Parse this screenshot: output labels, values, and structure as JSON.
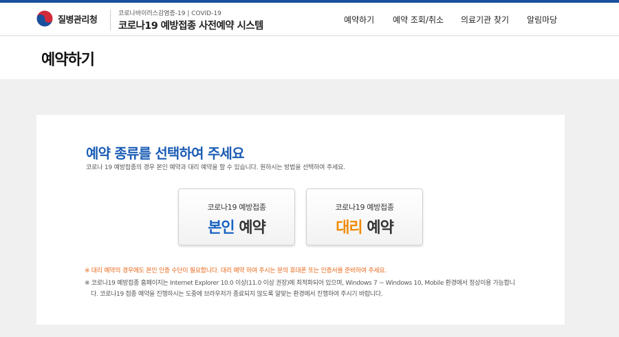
{
  "header": {
    "org_name": "질병관리청",
    "sub_title": "코로나바이러스감염증-19 | COVID-19",
    "system_title": "코로나19 예방접종 사전예약 시스템",
    "nav": [
      "예약하기",
      "예약 조회/취소",
      "의료기관 찾기",
      "알림마당"
    ]
  },
  "page": {
    "title": "예약하기"
  },
  "main": {
    "heading": "예약 종류를 선택하여 주세요",
    "description": "코로나 19 예방접종의 경우 본인 예약과 대리 예약을 할 수 있습니다. 원하시는 방법을 선택하여 주세요.",
    "options": [
      {
        "sub": "코로나19 예방접종",
        "highlight": "본인",
        "main": " 예약"
      },
      {
        "sub": "코로나19 예방접종",
        "highlight": "대리",
        "main": " 예약"
      }
    ],
    "notices": [
      "※ 대리 예약의 경우에도 본인 인증 수단이 필요합니다. 대리 예약 하여 주시는 분의 휴대폰 또는 인증서를 준비하여 주세요.",
      "※ 코로나19 예방접종 홈페이지는 Internet Explorer 10.0 이상(11.0 이상 권장)에 최적화되어 있으며, Windows 7 ~ Windows 10, Mobile 환경에서 정상이용 가능합니",
      "다. 코로나19 접종 예약을 진행하시는 도중에 브라우저가 종료되지 않도록 알맞는 환경에서 진행하여 주시기 바랍니다."
    ]
  },
  "colors": {
    "accent_blue": "#1a5cb4",
    "highlight_orange": "#f08a00",
    "notice_orange": "#e8691c",
    "top_bar": "#1a4f9c"
  },
  "icons": {
    "logo": "taegeuk-logo-icon"
  }
}
